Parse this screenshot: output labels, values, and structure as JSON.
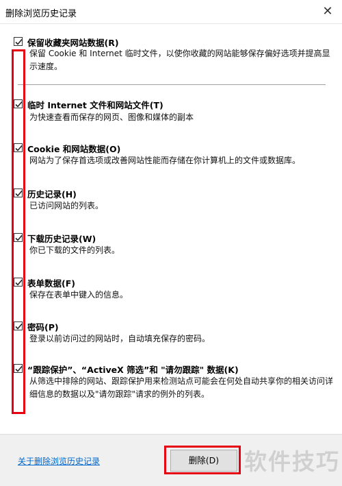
{
  "window": {
    "title": "删除浏览历史记录"
  },
  "options": [
    {
      "label": "保留收藏夹网站数据(R)",
      "desc": "保留 Cookie 和 Internet 临时文件，以使你收藏的网站能够保存偏好选项并提高显示速度。",
      "checked": true
    },
    {
      "label": "临时 Internet 文件和网站文件(T)",
      "desc": "为快速查看而保存的网页、图像和媒体的副本",
      "checked": true
    },
    {
      "label": "Cookie 和网站数据(O)",
      "desc": "网站为了保存首选项或改善网站性能而存储在你计算机上的文件或数据库。",
      "checked": true
    },
    {
      "label": "历史记录(H)",
      "desc": "已访问网站的列表。",
      "checked": true
    },
    {
      "label": "下载历史记录(W)",
      "desc": "你已下载的文件的列表。",
      "checked": true
    },
    {
      "label": "表单数据(F)",
      "desc": "保存在表单中键入的信息。",
      "checked": true
    },
    {
      "label": "密码(P)",
      "desc": "登录以前访问过的网站时，自动填充保存的密码。",
      "checked": true
    },
    {
      "label": "“跟踪保护”、“ActiveX 筛选”和 \"请勿跟踪\" 数据(K)",
      "desc": "从筛选中排除的网站、跟踪保护用来检测站点可能会在何处自动共享你的相关访问详细信息的数据以及\"请勿跟踪\"请求的例外的列表。",
      "checked": true
    }
  ],
  "footer": {
    "about_link": "关于删除浏览历史记录",
    "delete_button": "删除(D)"
  },
  "watermark": "软件技巧",
  "colors": {
    "highlight": "#e60012",
    "link": "#0066cc"
  }
}
